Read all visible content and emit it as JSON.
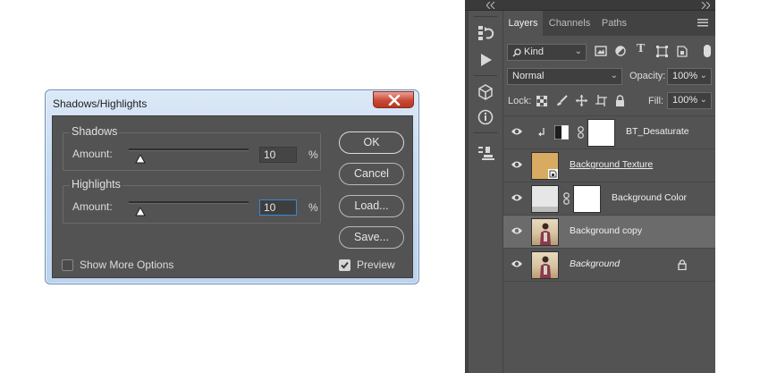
{
  "dialog": {
    "title": "Shadows/Highlights",
    "shadows": {
      "label": "Shadows",
      "amount_label": "Amount:",
      "value": "10",
      "unit": "%",
      "slider_fraction": 0.1
    },
    "highlights": {
      "label": "Highlights",
      "amount_label": "Amount:",
      "value": "10",
      "unit": "%",
      "slider_fraction": 0.1
    },
    "buttons": {
      "ok": "OK",
      "cancel": "Cancel",
      "load": "Load...",
      "save": "Save..."
    },
    "show_more_options": {
      "label": "Show More Options",
      "checked": false
    },
    "preview": {
      "label": "Preview",
      "checked": true
    },
    "colors": {
      "body": "#535353",
      "close_button": "#c94a36",
      "focus": "#3a88d6"
    }
  },
  "panel": {
    "tabs": [
      "Layers",
      "Channels",
      "Paths"
    ],
    "active_tab": "Layers",
    "filter": {
      "value": "Kind",
      "icons": [
        "image-filter-icon",
        "adjustment-filter-icon",
        "type-filter-icon",
        "shape-filter-icon",
        "smart-object-filter-icon"
      ]
    },
    "blend_mode": "Normal",
    "opacity_label": "Opacity:",
    "opacity": "100%",
    "lock_label": "Lock:",
    "fill_label": "Fill:",
    "fill": "100%",
    "layers": [
      {
        "name": "BT_Desaturate",
        "type": "adjustment",
        "clipped": true,
        "has_mask": true,
        "selected": false
      },
      {
        "name": "Background Texture",
        "type": "smart-object",
        "thumb_color": "#d9ab62",
        "underline": true,
        "selected": false
      },
      {
        "name": "Background Color",
        "type": "fill",
        "has_mask": true,
        "selected": false
      },
      {
        "name": "Background copy",
        "type": "photo",
        "selected": true
      },
      {
        "name": "Background",
        "type": "photo",
        "italic": true,
        "locked": true,
        "selected": false
      }
    ],
    "colors": {
      "panel": "#535353",
      "selected_row": "#6b6b6b"
    }
  },
  "toolstrip": {
    "icons": [
      "history-icon",
      "play-actions-icon",
      "3d-icon",
      "info-icon",
      "properties-icon"
    ]
  }
}
